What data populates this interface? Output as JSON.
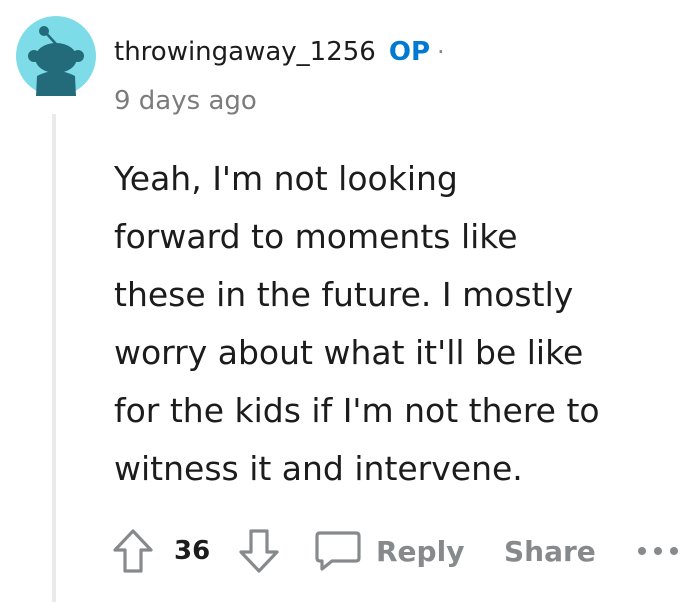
{
  "comment": {
    "username": "throwingaway_1256",
    "op_badge": "OP",
    "separator": "·",
    "timestamp": "9 days ago",
    "avatar_icon": "reddit-snoo-avatar-icon",
    "body_lines": [
      "Yeah, I'm not looking",
      "forward to moments like",
      "these in the future. I mostly",
      "worry about what it'll be like",
      "for the kids if I'm not there to",
      "witness it and intervene."
    ]
  },
  "actions": {
    "upvote_icon": "arrow-up-icon",
    "vote_count": "36",
    "downvote_icon": "arrow-down-icon",
    "reply_icon": "speech-bubble-icon",
    "reply_label": "Reply",
    "share_label": "Share",
    "more_icon": "ellipsis-icon",
    "more_label": "•••"
  },
  "colors": {
    "op_badge": "#0079d3",
    "avatar_bg": "#7ddce8",
    "avatar_figure": "#236a7b",
    "muted": "#878a8c",
    "thread_line": "#e9eaeb"
  }
}
